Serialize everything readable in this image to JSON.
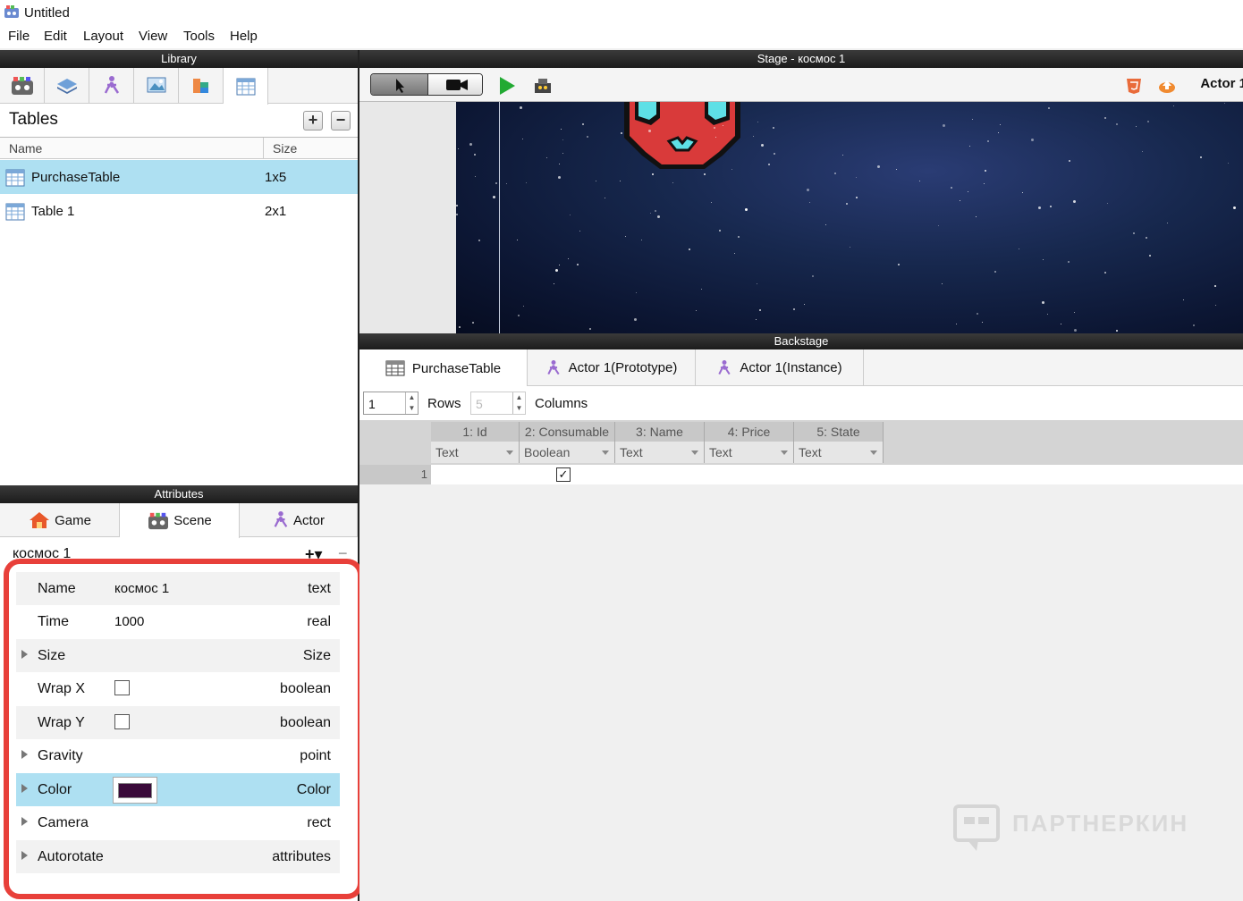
{
  "window": {
    "title": "Untitled"
  },
  "menu": [
    "File",
    "Edit",
    "Layout",
    "View",
    "Tools",
    "Help"
  ],
  "library": {
    "header": "Library",
    "tabs": [
      "scene-icon",
      "layers-icon",
      "actor-icon",
      "image-icon",
      "blocks-icon",
      "table-icon"
    ],
    "section_title": "Tables",
    "columns": {
      "name": "Name",
      "size": "Size"
    },
    "rows": [
      {
        "name": "PurchaseTable",
        "size": "1x5"
      },
      {
        "name": "Table 1",
        "size": "2x1"
      }
    ]
  },
  "attributes": {
    "header": "Attributes",
    "tabs": {
      "game": "Game",
      "scene": "Scene",
      "actor": "Actor"
    },
    "scene_name": "космос 1",
    "rows": [
      {
        "key": "Name",
        "value": "космос 1",
        "type": "text"
      },
      {
        "key": "Time",
        "value": "1000",
        "type": "real"
      },
      {
        "key": "Size",
        "value": "",
        "type": "Size"
      },
      {
        "key": "Wrap X",
        "value": "",
        "type": "boolean"
      },
      {
        "key": "Wrap Y",
        "value": "",
        "type": "boolean"
      },
      {
        "key": "Gravity",
        "value": "",
        "type": "point"
      },
      {
        "key": "Color",
        "value": "",
        "type": "Color"
      },
      {
        "key": "Camera",
        "value": "",
        "type": "rect"
      },
      {
        "key": "Autorotate",
        "value": "",
        "type": "attributes"
      }
    ],
    "color_swatch": "#3a0a3a"
  },
  "stage": {
    "header": "Stage - космос 1",
    "actor_label": "Actor 1"
  },
  "backstage": {
    "header": "Backstage",
    "tabs": [
      "PurchaseTable",
      "Actor 1(Prototype)",
      "Actor 1(Instance)"
    ],
    "rows_value": "1",
    "rows_label": "Rows",
    "columns_value": "5",
    "columns_label": "Columns",
    "columns": [
      {
        "header": "1: Id",
        "type": "Text"
      },
      {
        "header": "2: Consumable",
        "type": "Boolean"
      },
      {
        "header": "3: Name",
        "type": "Text"
      },
      {
        "header": "4: Price",
        "type": "Text"
      },
      {
        "header": "5: State",
        "type": "Text"
      }
    ],
    "row_number": "1",
    "checkbox_mark": "✓"
  },
  "watermark": "ПАРТНЕРКИН",
  "colors": {
    "selection": "#aee0f2",
    "highlight": "#e8403a",
    "accent_green": "#22aa33"
  }
}
